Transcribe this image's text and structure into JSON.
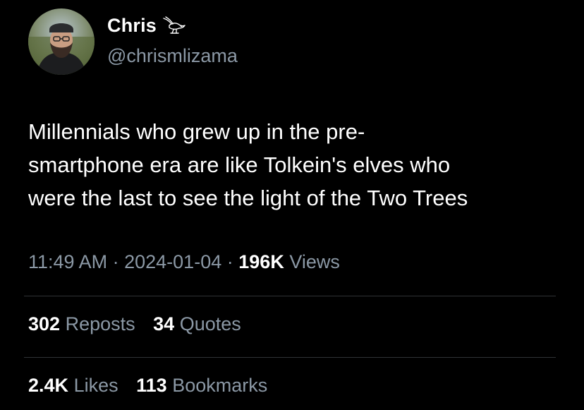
{
  "author": {
    "display_name": "Chris",
    "handle": "@chrismlizama",
    "badge_icon": "bird-icon",
    "avatar_icon": "avatar-photo"
  },
  "tweet": {
    "text": "Millennials who grew up in the pre-\nsmartphone era are like Tolkein's elves who\nwere the last to see the light of the Two Trees"
  },
  "meta": {
    "time": "11:49 AM",
    "separator": "·",
    "date": "2024-01-04",
    "views_count": "196K",
    "views_label": "Views"
  },
  "stats": {
    "reposts_count": "302",
    "reposts_label": "Reposts",
    "quotes_count": "34",
    "quotes_label": "Quotes",
    "likes_count": "2.4K",
    "likes_label": "Likes",
    "bookmarks_count": "113",
    "bookmarks_label": "Bookmarks"
  },
  "colors": {
    "background": "#000000",
    "primary_text": "#ffffff",
    "secondary_text": "#8b98a5",
    "divider": "#2f3336"
  }
}
